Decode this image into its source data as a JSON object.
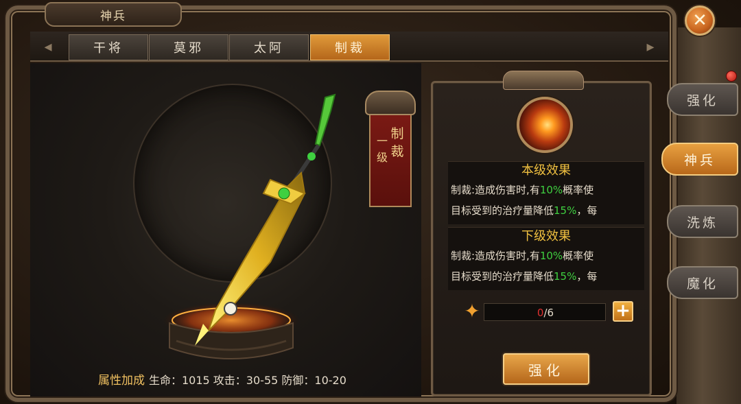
{
  "window": {
    "title": "神兵"
  },
  "tabs": [
    {
      "label": "干将",
      "active": false
    },
    {
      "label": "莫邪",
      "active": false
    },
    {
      "label": "太阿",
      "active": false
    },
    {
      "label": "制裁",
      "active": true
    }
  ],
  "rank": {
    "level": "一级",
    "name": "制裁"
  },
  "stats": {
    "label": "属性加成",
    "text": "生命：1015 攻击：30-55 防御：10-20"
  },
  "effects": {
    "current_title": "本级效果",
    "current_line1_pre": "制裁:造成伤害时,有",
    "current_line1_pct": "10%",
    "current_line1_post": "概率使",
    "current_line2_pre": "目标受到的治疗量降低",
    "current_line2_pct": "15%",
    "current_line2_post": "，每",
    "next_title": "下级效果",
    "next_line1_pre": "制裁:造成伤害时,有",
    "next_line1_pct": "10%",
    "next_line1_post": "概率使",
    "next_line2_pre": "目标受到的治疗量降低",
    "next_line2_pct": "15%",
    "next_line2_post": "，每"
  },
  "progress": {
    "current": "0",
    "sep_max": "/6",
    "fraction": 0.0
  },
  "buttons": {
    "strengthen": "强化",
    "close_icon": "close-icon",
    "plus_icon": "plus-icon"
  },
  "side_tabs": [
    {
      "label": "强化",
      "active": false
    },
    {
      "label": "神兵",
      "active": true
    },
    {
      "label": "洗炼",
      "active": false
    },
    {
      "label": "魔化",
      "active": false
    }
  ],
  "colors": {
    "accent": "#e09a3a",
    "highlight_green": "#3fd040",
    "progress_current": "#e03030",
    "effect_title": "#f0c040"
  }
}
